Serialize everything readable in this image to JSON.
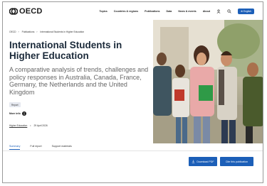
{
  "header": {
    "logo_text": "OECD",
    "nav": [
      "Topics",
      "Countries & regions",
      "Publications",
      "Data",
      "News & events",
      "About"
    ],
    "english_label": "English"
  },
  "breadcrumb": [
    "OECD",
    "Publications",
    "International Students in Higher Education"
  ],
  "title": "International Students in Higher Education",
  "subtitle": "A comparative analysis of trends, challenges and policy responses in Australia, Canada, France, Germany, the Netherlands and the United Kingdom",
  "badge": "Report",
  "more_info": "More info",
  "meta": {
    "topic": "Higher Education",
    "separator": "•",
    "date": "29 April 2026"
  },
  "tabs": [
    "Summary",
    "Full report",
    "Support materials"
  ],
  "buttons": {
    "download": "Download PDF",
    "cite": "Cite this publication"
  },
  "colors": {
    "accent": "#1c5fb8",
    "title": "#1b2a3a"
  }
}
